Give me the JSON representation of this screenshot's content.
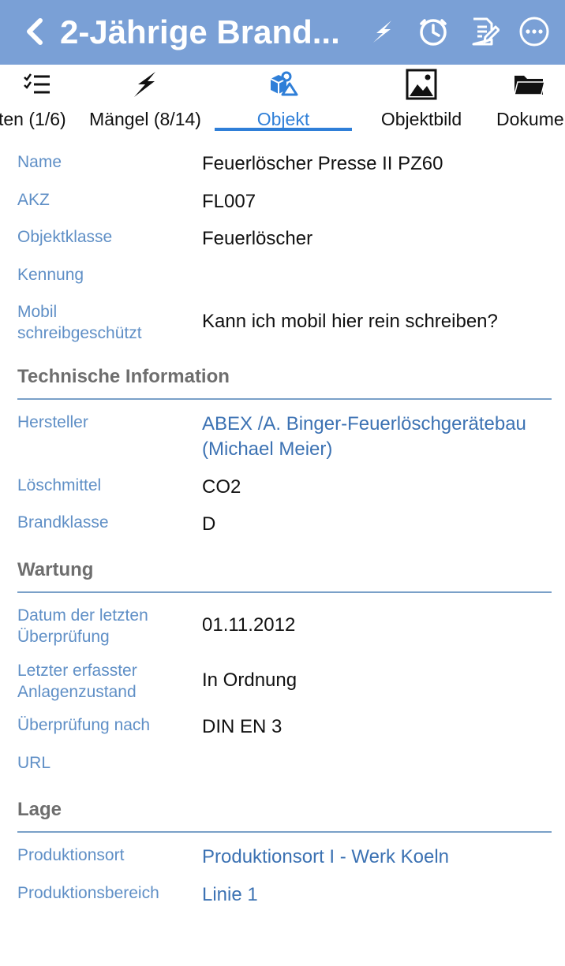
{
  "header": {
    "title": "2-Jährige Brand...",
    "back_icon": "chevron-left-icon",
    "actions": [
      "lightning-icon",
      "clock-icon",
      "edit-document-icon",
      "more-icon"
    ],
    "bar_color": "#7aa0d6"
  },
  "tabs": [
    {
      "label": "ten (1/6)",
      "icon": "checklist-icon"
    },
    {
      "label": "Mängel (8/14)",
      "icon": "lightning-icon"
    },
    {
      "label": "Objekt",
      "icon": "objects-icon",
      "active": true
    },
    {
      "label": "Objektbild",
      "icon": "image-icon"
    },
    {
      "label": "Dokume",
      "icon": "folder-icon"
    }
  ],
  "fields": {
    "name": {
      "label": "Name",
      "value": "Feuerlöscher Presse  II PZ60"
    },
    "akz": {
      "label": "AKZ",
      "value": "FL007"
    },
    "objektklasse": {
      "label": "Objektklasse",
      "value": "Feuerlöscher"
    },
    "kennung": {
      "label": "Kennung",
      "value": ""
    },
    "mobil": {
      "label1": "Mobil",
      "label2": "schreibgeschützt",
      "value": "Kann ich mobil hier rein schreiben?"
    }
  },
  "technische_information": {
    "heading": "Technische Information",
    "hersteller": {
      "label": "Hersteller",
      "value1": "ABEX /A. Binger-Feuerlöschgerätebau",
      "value2": "(Michael Meier)"
    },
    "loeschmittel": {
      "label": "Löschmittel",
      "value": "CO2"
    },
    "brandklasse": {
      "label": "Brandklasse",
      "value": "D"
    }
  },
  "wartung": {
    "heading": "Wartung",
    "datum": {
      "label1": "Datum der letzten",
      "label2": "Überprüfung",
      "value": "01.11.2012"
    },
    "zustand": {
      "label1": "Letzter erfasster",
      "label2": "Anlagenzustand",
      "value": "In Ordnung"
    },
    "ueberpruefung_nach": {
      "label": "Überprüfung nach",
      "value": "DIN EN 3"
    },
    "url": {
      "label": "URL",
      "value": ""
    }
  },
  "lage": {
    "heading": "Lage",
    "produktionsort": {
      "label": "Produktionsort",
      "value": "Produktionsort I - Werk Koeln"
    },
    "produktionsbereich": {
      "label": "Produktionsbereich",
      "value": "Linie 1"
    }
  },
  "colors": {
    "label": "#5f8fc6",
    "link": "#3c72b3",
    "active_tab": "#2f7fd8",
    "section": "#6e6e6e"
  }
}
